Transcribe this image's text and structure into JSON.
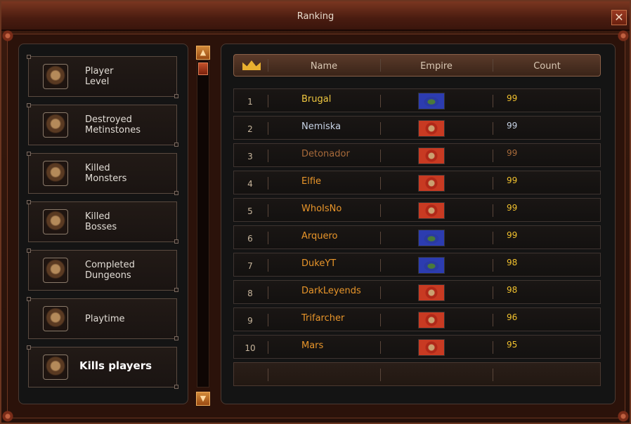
{
  "window": {
    "title": "Ranking",
    "close_label": "✕"
  },
  "categories": [
    {
      "label": "Player\nLevel",
      "icon": "player-level-icon"
    },
    {
      "label": "Destroyed\nMetinstones",
      "icon": "metinstone-icon"
    },
    {
      "label": "Killed\nMonsters",
      "icon": "monster-icon"
    },
    {
      "label": "Killed\nBosses",
      "icon": "boss-icon"
    },
    {
      "label": "Completed\nDungeons",
      "icon": "dungeon-icon"
    },
    {
      "label": "Playtime",
      "icon": "playtime-icon"
    },
    {
      "label": "Kills players",
      "icon": "kills-players-icon",
      "active": true
    }
  ],
  "scrollbar": {
    "up": "▲",
    "down": "▼"
  },
  "table": {
    "headers": {
      "name": "Name",
      "empire": "Empire",
      "count": "Count"
    },
    "rows": [
      {
        "rank": "1",
        "name": "Brugal",
        "empire": "blue",
        "count": "99"
      },
      {
        "rank": "2",
        "name": "Nemiska",
        "empire": "red",
        "count": "99"
      },
      {
        "rank": "3",
        "name": "Detonador",
        "empire": "red",
        "count": "99"
      },
      {
        "rank": "4",
        "name": "Elfie",
        "empire": "red",
        "count": "99"
      },
      {
        "rank": "5",
        "name": "WhoIsNo",
        "empire": "red",
        "count": "99"
      },
      {
        "rank": "6",
        "name": "Arquero",
        "empire": "blue",
        "count": "99"
      },
      {
        "rank": "7",
        "name": "DukeYT",
        "empire": "blue",
        "count": "98"
      },
      {
        "rank": "8",
        "name": "DarkLeyends",
        "empire": "red",
        "count": "98"
      },
      {
        "rank": "9",
        "name": "Trifarcher",
        "empire": "red",
        "count": "96"
      },
      {
        "rank": "10",
        "name": "Mars",
        "empire": "red",
        "count": "95"
      }
    ]
  },
  "colors": {
    "gold": "#f0c840",
    "silver": "#c8d4e6",
    "bronze": "#a86a3a",
    "orange": "#e8952a",
    "count_yellow": "#f2c22e"
  }
}
